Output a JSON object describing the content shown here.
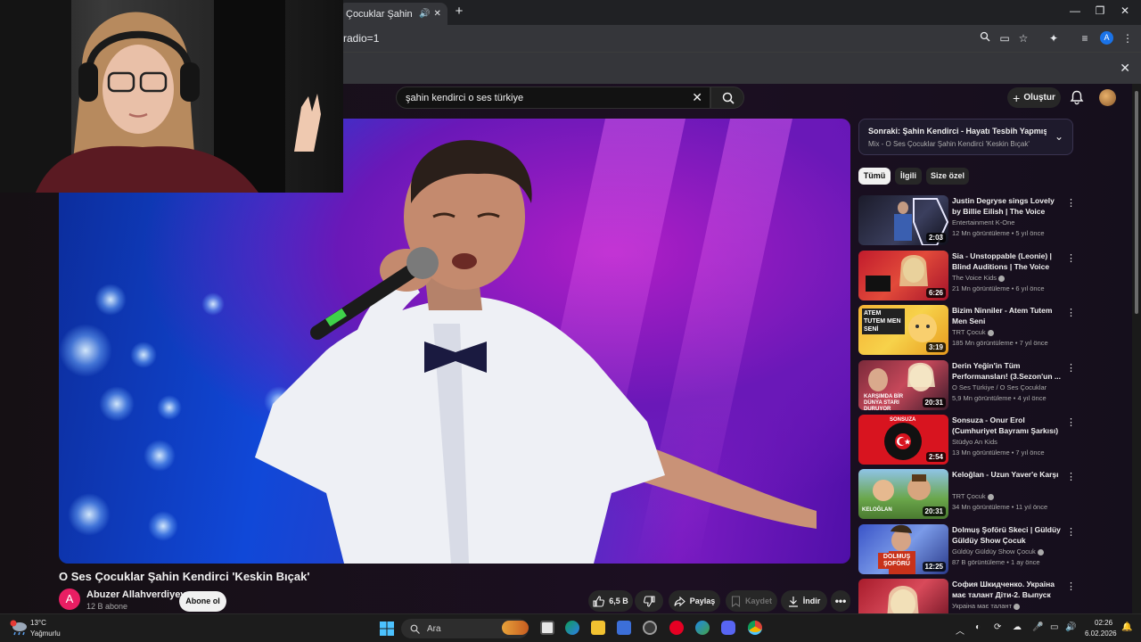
{
  "browser": {
    "tab_title": "Çocuklar Şahin Kendi",
    "new_tab": "+",
    "url": "radio=1",
    "profile_initial": "A"
  },
  "youtube": {
    "search_value": "şahin kendirci o ses türkiye",
    "create_label": "Oluştur",
    "video": {
      "title": "O Ses Çocuklar Şahin Kendirci 'Keskin Bıçak'",
      "channel_initial": "A",
      "channel_name": "Abuzer Allahverdiyev",
      "subscribers": "12 B abone",
      "subscribe_label": "Abone ol",
      "likes": "6,5 B",
      "share_label": "Paylaş",
      "save_label": "Kaydet",
      "download_label": "İndir"
    },
    "upnext": {
      "title": "Sonraki: Şahin Kendirci - Hayatı Tesbih Yapmışım (...",
      "subtitle": "Mix - O Ses Çocuklar Şahin Kendirci 'Keskin Bıçak'"
    },
    "chips": [
      "Tümü",
      "İlgili",
      "Size özel"
    ],
    "recommendations": [
      {
        "title": "Justin Degryse sings Lovely by Billie Eilish | The Voice Kids ...",
        "channel": "Entertainment K-One",
        "views": "12 Mn görüntüleme",
        "age": "5 yıl önce",
        "duration": "2:03",
        "verified": false
      },
      {
        "title": "Sia - Unstoppable (Leonie) | Blind Auditions | The Voice Kid...",
        "channel": "The Voice Kids",
        "views": "21 Mn görüntüleme",
        "age": "6 yıl önce",
        "duration": "6:26",
        "verified": true
      },
      {
        "title": "Bizim Ninniler - Atem Tutem Men Seni",
        "channel": "TRT Çocuk",
        "views": "185 Mn görüntüleme",
        "age": "7 yıl önce",
        "duration": "3:19",
        "verified": true
      },
      {
        "title": "Derin Yeğin'in Tüm Performansları! (3.Sezon'un ...",
        "channel": "O Ses Türkiye / O Ses Çocuklar",
        "views": "5,9 Mn görüntüleme",
        "age": "4 yıl önce",
        "duration": "20:31",
        "verified": false
      },
      {
        "title": "Sonsuza - Onur Erol (Cumhuriyet Bayramı Şarkısı)",
        "channel": "Stüdyo An Kids",
        "views": "13 Mn görüntüleme",
        "age": "7 yıl önce",
        "duration": "2:54",
        "verified": false
      },
      {
        "title": "Keloğlan - Uzun Yaver'e Karşı",
        "channel": "TRT Çocuk",
        "views": "34 Mn görüntüleme",
        "age": "11 yıl önce",
        "duration": "20:31",
        "verified": true
      },
      {
        "title": "Dolmuş Şoförü Skeci | Güldüy Güldüy Show Çocuk",
        "channel": "Güldüy Güldüy Show Çocuk",
        "views": "87 B görüntüleme",
        "age": "1 ay önce",
        "duration": "12:25",
        "verified": true
      },
      {
        "title": "София Шкидченко. Украіна має талант Діти-2. Выпуск 1...",
        "channel": "Украіна має талант",
        "views": "",
        "age": "",
        "duration": "",
        "verified": true
      }
    ],
    "thumb_texts": {
      "rec3": "ATEM TUTEM MEN SENİ",
      "rec4": "KARŞIMDA BİR DÜNYA STARI DURUYOR",
      "rec5": "SONSUZA",
      "rec6": "KELOĞLAN",
      "rec7": "DOLMUŞ ŞOFÖRÜ"
    }
  },
  "taskbar": {
    "weather_temp": "13°C",
    "weather_desc": "Yağmurlu",
    "search_placeholder": "Ara",
    "time": "02:26",
    "date": "6.02.2026"
  },
  "colors": {
    "accent": "#f1f1f1",
    "subscribe_avatar": "#e91e63",
    "browser_profile": "#1a73e8"
  }
}
